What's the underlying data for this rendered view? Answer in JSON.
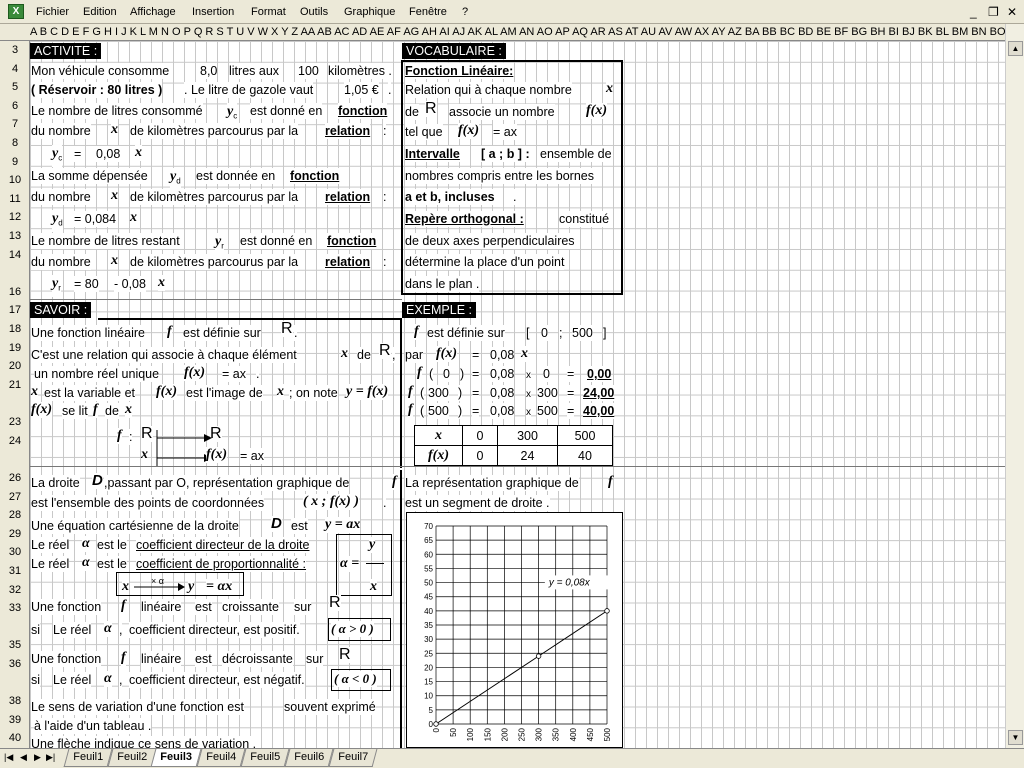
{
  "menu": {
    "items": [
      "Fichier",
      "Edition",
      "Affichage",
      "Insertion",
      "Format",
      "Outils",
      "Graphique",
      "Fenêtre",
      "?"
    ]
  },
  "column_letters": "A B C D E F G H I J K L M N O P Q R S T U V W X Y Z AA AB AC AD AE AF AG AH AI AJ AK AL AM AN AO AP AQ AR AS AT AU AV AW AX AY AZ BA BB BC BD BE BF BG BH BI BJ BK BL BM BN BO BP BQ BR BS BT BU BV BW BX BY BZ CA CB CC CD CE CF CG",
  "rows": [
    "3",
    "4",
    "5",
    "6",
    "7",
    "8",
    "9",
    "10",
    "11",
    "12",
    "13",
    "14",
    "",
    "16",
    "17",
    "18",
    "19",
    "20",
    "21",
    "",
    "23",
    "24",
    "",
    "26",
    "27",
    "28",
    "29",
    "30",
    "31",
    "32",
    "33",
    "",
    "35",
    "36",
    "",
    "38",
    "39",
    "40"
  ],
  "tabs": [
    "Feuil1",
    "Feuil2",
    "Feuil3",
    "Feuil4",
    "Feuil5",
    "Feuil6",
    "Feuil7"
  ],
  "activite": {
    "header": "ACTIVITE :",
    "r4": {
      "a": "Mon véhicule consomme",
      "b": "8,0",
      "c": "litres aux",
      "d": "100",
      "e": "kilomètres ."
    },
    "r5": {
      "a": "( Réservoir : 80 litres )",
      "b": ". Le litre de gazole vaut",
      "c": "1,05 €",
      "d": "."
    },
    "r6": {
      "a": "Le nombre de litres consommé",
      "v": "y",
      "s": "c",
      "b": "est donné en",
      "c": "fonction"
    },
    "r7": {
      "a": "du nombre",
      "x": "x",
      "b": "de kilomètres parcourus par la",
      "c": "relation",
      ":": ":"
    },
    "r8": {
      "v": "y",
      "s": "c",
      "eq": "=",
      "n": "0,08",
      "x": "x"
    },
    "r9": {
      "a": "La somme dépensée",
      "v": "y",
      "s": "d",
      "b": "est donnée en",
      "c": "fonction"
    },
    "r10": {
      "a": "du nombre",
      "x": "x",
      "b": "de kilomètres parcourus par la",
      "c": "relation",
      ":": ":"
    },
    "r11": {
      "v": "y",
      "s": "d",
      "n": "= 0,084",
      "x": "x"
    },
    "r12": {
      "a": "Le nombre de litres restant",
      "v": "y",
      "s": "r",
      "b": "est donné en",
      "c": "fonction"
    },
    "r13": {
      "a": "du nombre",
      "x": "x",
      "b": "de kilomètres parcourus par la",
      "c": "relation",
      ":": ":"
    },
    "r14": {
      "v": "y",
      "s": "r",
      "n": "= 80",
      "m": "- 0,08",
      "x": "x"
    }
  },
  "vocabulaire": {
    "header": "VOCABULAIRE :",
    "l1": "Fonction Linéaire:",
    "l2a": "Relation qui à chaque nombre",
    "l2x": "x",
    "l3a": "de",
    "l3R": "R",
    "l3b": "associe un nombre",
    "l3f": "f(x)",
    "l4a": "tel que",
    "l4f": "f(x)",
    "l4b": "= ax",
    "l5a": "Intervalle",
    "l5b": "[ a ; b ] :",
    "l5c": "ensemble de",
    "l6": "nombres compris entre les bornes",
    "l7a": "a et b, incluses",
    "l7b": ".",
    "l8a": "Repère orthogonal :",
    "l8b": "constitué",
    "l9": "de deux axes perpendiculaires",
    "l10": "détermine la place d'un point",
    "l11": "dans le plan ."
  },
  "savoir": {
    "header": "SAVOIR :",
    "r17": {
      "a": "Une fonction linéaire",
      "f": "f",
      "b": "est définie sur",
      "R": "R",
      "c": "."
    },
    "r18": {
      "a": "C'est une relation qui associe à chaque élément",
      "x": "x",
      "b": "de",
      "R": "R",
      ",": ","
    },
    "r19": {
      "a": "un nombre réel unique",
      "f": "f(x)",
      "b": "= ax",
      "c": "."
    },
    "r20": {
      "x": "x",
      "a": "est la variable et",
      "fx": "f(x)",
      "b": "est l'image de",
      "x2": "x",
      "c": "; on note",
      "y": "y = f(x)"
    },
    "r21": {
      "f": "f(x)",
      "a": "se lit",
      "ff": "f",
      "b": "de",
      "x": "x"
    },
    "r23": {
      "f": "f",
      "c": ":",
      "R1": "R",
      "R2": "R"
    },
    "r24": {
      "x": "x",
      "fx": "f(x)",
      "eq": "= ax"
    }
  },
  "exemple": {
    "header": "EXEMPLE :",
    "r17": {
      "f": "f",
      "a": "est définie sur",
      "b": "[",
      "c": "0",
      "d": ";",
      "e": "500",
      "g": "]"
    },
    "r18": {
      "a": "par",
      "f": "f(x)",
      "eq": "=",
      "n": "0,08",
      "x": "x"
    },
    "r19": {
      "f": "f",
      "p": "(",
      "v": "0",
      "q": ")",
      "eq": "=",
      "n": "0,08",
      "x": "x",
      "v2": "0",
      "e2": "=",
      "r": "0,00"
    },
    "r20": {
      "f": "f",
      "p": "(",
      "v": "300",
      "q": ")",
      "eq": "=",
      "n": "0,08",
      "x": "x",
      "v2": "300",
      "e2": "=",
      "r": "24,00"
    },
    "r21": {
      "f": "f",
      "p": "(",
      "v": "500",
      "q": ")",
      "eq": "=",
      "n": "0,08",
      "x": "x",
      "v2": "500",
      "e2": "=",
      "r": "40,00"
    },
    "table": {
      "h1": "x",
      "h2": "f(x)",
      "xs": [
        "0",
        "300",
        "500"
      ],
      "ys": [
        "0",
        "24",
        "40"
      ]
    }
  },
  "droite": {
    "r26": {
      "a": "La droite",
      "D": "D",
      "b": ",passant par O, représentation graphique de",
      "f": "f"
    },
    "r27": {
      "a": "est l'ensemble des points de coordonnées",
      "b": "( x ; f(x) )",
      "c": "."
    },
    "r28": {
      "a": "Une équation cartésienne de la droite",
      "D": "D",
      "b": "est",
      "c": "y = ax"
    },
    "r29": {
      "a": "Le réel",
      "al": "α",
      "b": "est le",
      "c": "coefficient directeur de la droite",
      "y": "y"
    },
    "r30": {
      "a": "Le réel",
      "al": "α",
      "b": "est le",
      "c": "coefficient de proportionnalité :",
      "eq": "α =",
      "x": "x"
    },
    "r31": {
      "x": "x",
      "xa": "× α",
      "y": "y",
      "eq": "= αx"
    },
    "r32": {
      "a": "Une fonction",
      "f": "f",
      "b": "linéaire",
      "c": "est",
      "d": "croissante",
      "e": "sur",
      "R": "R"
    },
    "r33": {
      "a": "si",
      "b": "Le réel",
      "al": "α",
      ",": ",",
      "c": "coefficient directeur, est positif.",
      "d": "( α > 0 )"
    },
    "r35": {
      "a": "Une fonction",
      "f": "f",
      "b": "linéaire",
      "c": "est",
      "d": "décroissante",
      "e": "sur",
      "R": "R"
    },
    "r36": {
      "a": "si",
      "b": "Le réel",
      "al": "α",
      ",": ",",
      "c": "coefficient directeur, est négatif.",
      "d": "( α < 0 )"
    },
    "r38": {
      "a": "Le sens de variation d'une fonction est",
      "b": "souvent exprimé"
    },
    "r39": "à l'aide d'un tableau .",
    "r40": "Une flèche indique ce sens de variation ."
  },
  "graph_text": {
    "r26a": "La représentation graphique de",
    "f": "f",
    "r27": "est un segment de droite ."
  },
  "chart_data": {
    "type": "line",
    "x": [
      0,
      300,
      500
    ],
    "y": [
      0,
      24,
      40
    ],
    "series": [
      {
        "name": "y = 0,08x",
        "x": [
          0,
          300,
          500
        ],
        "values": [
          0,
          24,
          40
        ]
      }
    ],
    "xlim": [
      0,
      500
    ],
    "ylim": [
      0,
      70
    ],
    "xticks": [
      "0",
      "50",
      "100",
      "150",
      "200",
      "250",
      "300",
      "350",
      "400",
      "450",
      "500"
    ],
    "yticks": [
      "0",
      "5",
      "10",
      "15",
      "20",
      "25",
      "30",
      "35",
      "40",
      "45",
      "50",
      "55",
      "60",
      "65",
      "70"
    ],
    "grid": true,
    "annotation": "y = 0,08x"
  }
}
